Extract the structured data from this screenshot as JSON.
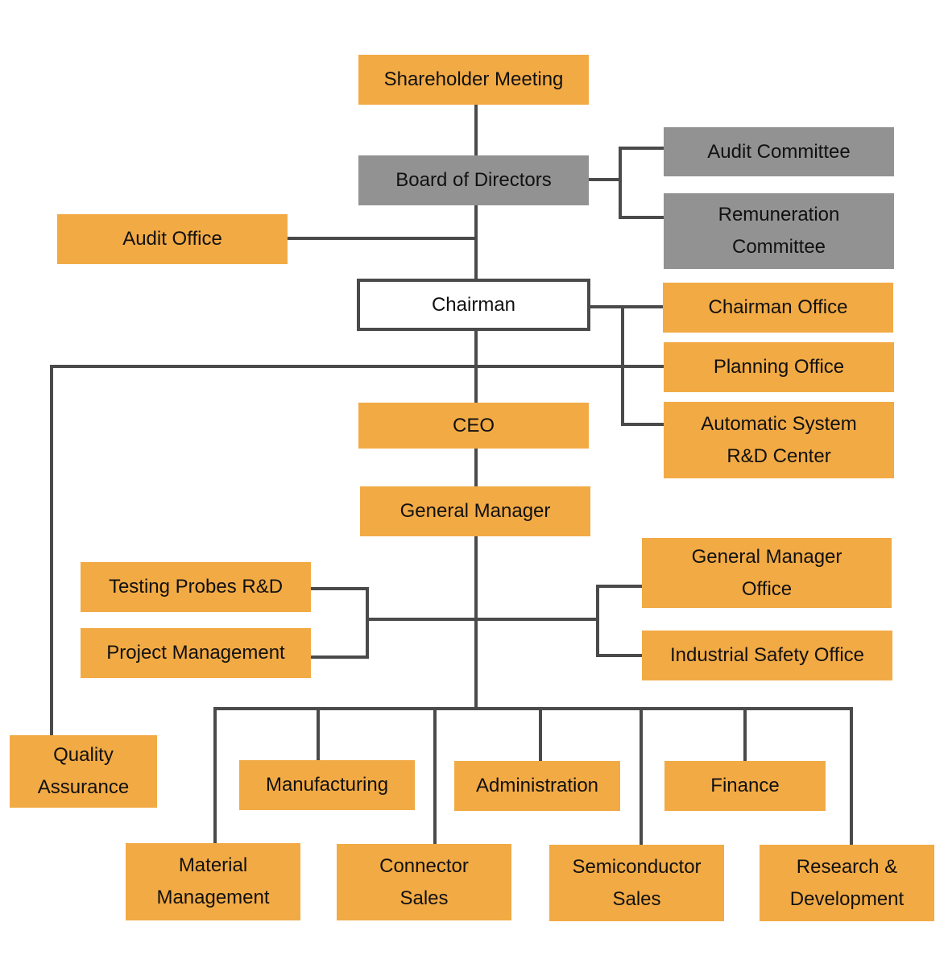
{
  "colors": {
    "unit": "#f2aa45",
    "board": "#929292",
    "line": "#4a4a4a"
  },
  "nodes": {
    "shareholder": "Shareholder Meeting",
    "board": "Board of Directors",
    "audit_committee": "Audit Committee",
    "remuneration": "Remuneration\nCommittee",
    "audit_office": "Audit Office",
    "chairman": "Chairman",
    "chairman_office": "Chairman Office",
    "planning_office": "Planning Office",
    "auto_system": "Automatic System\nR&D Center",
    "ceo": "CEO",
    "gm": "General Manager",
    "testing_probes": "Testing Probes R&D",
    "project_mgmt": "Project Management",
    "gm_office": "General Manager\nOffice",
    "industrial_safety": "Industrial Safety Office",
    "quality": "Quality\nAssurance",
    "manufacturing": "Manufacturing",
    "administration": "Administration",
    "finance": "Finance",
    "material": "Material\nManagement",
    "connector": "Connector\nSales",
    "semiconductor": "Semiconductor\nSales",
    "rnd": "Research &\nDevelopment"
  }
}
